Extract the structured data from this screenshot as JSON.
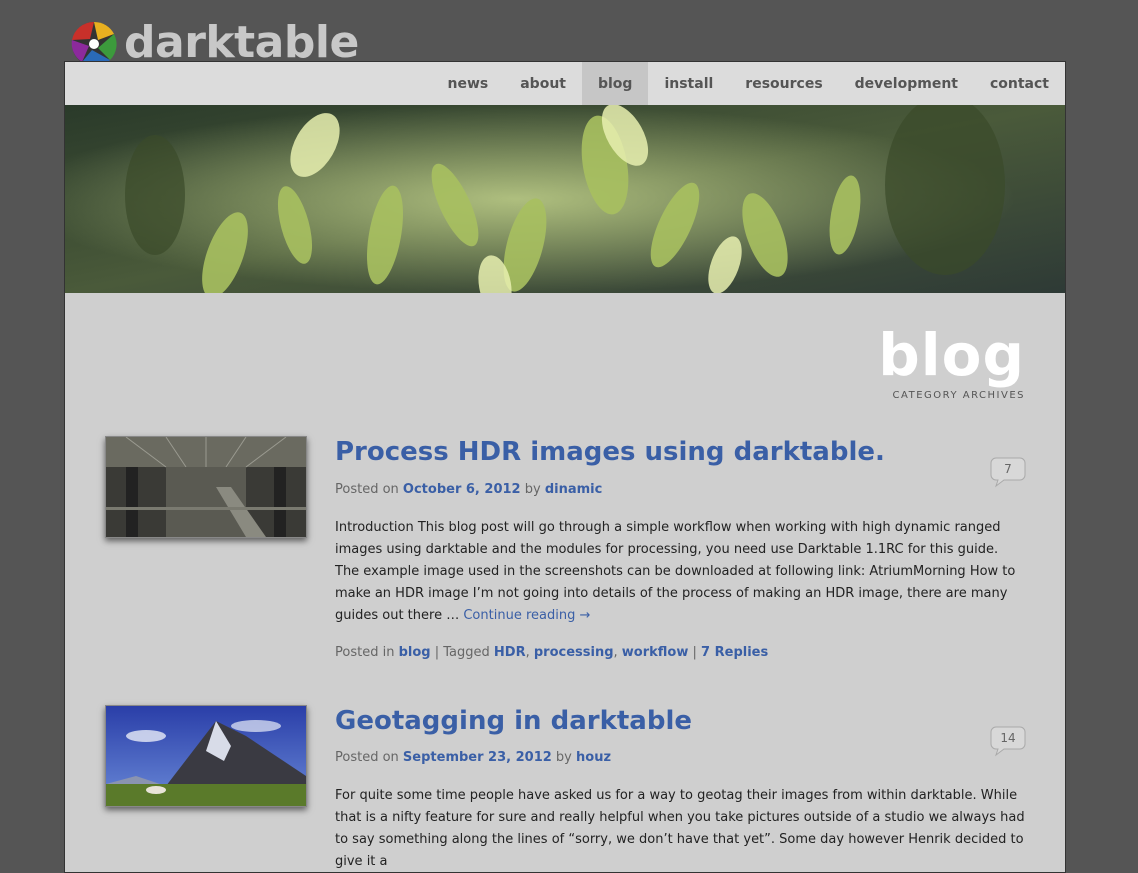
{
  "site": {
    "brand": "darktable"
  },
  "nav": {
    "items": [
      {
        "label": "news",
        "active": false
      },
      {
        "label": "about",
        "active": false
      },
      {
        "label": "blog",
        "active": true
      },
      {
        "label": "install",
        "active": false
      },
      {
        "label": "resources",
        "active": false
      },
      {
        "label": "development",
        "active": false
      },
      {
        "label": "contact",
        "active": false
      }
    ]
  },
  "archive": {
    "title": "blog",
    "subtitle": "CATEGORY ARCHIVES"
  },
  "posts": [
    {
      "title": "Process HDR images using darktable.",
      "posted_on_prefix": "Posted on",
      "date": "October 6, 2012",
      "by": "by",
      "author": "dinamic",
      "excerpt": "Introduction This blog post will go through a simple workflow when working with high dynamic ranged images using darktable and the modules for processing, you need use Darktable 1.1RC for this guide. The example image used in the screenshots can be downloaded at following link: AtriumMorning How to make an HDR image I’m not going into details of the process of making an HDR image, there are many guides out there …",
      "continue_label": "Continue reading →",
      "posted_in_prefix": "Posted in",
      "category": "blog",
      "separator1": "|",
      "tagged_prefix": "Tagged",
      "tags": [
        "HDR",
        "processing",
        "workflow"
      ],
      "separator2": "|",
      "replies_label": "7 Replies",
      "comment_count": "7",
      "thumb_icon": "atrium-photo"
    },
    {
      "title": "Geotagging in darktable",
      "posted_on_prefix": "Posted on",
      "date": "September 23, 2012",
      "by": "by",
      "author": "houz",
      "excerpt": "For quite some time people have asked us for a way to geotag their images from within darktable. While that is a nifty feature for sure and really helpful when you take pictures outside of a studio we always had to say something along the lines of “sorry, we don’t have that yet”. Some day however Henrik decided to give it a",
      "comment_count": "14",
      "thumb_icon": "mountain-photo"
    }
  ],
  "colors": {
    "background": "#555555",
    "page": "#cfcfcf",
    "link": "#3a5fa6",
    "nav_active": "#c6c6c6"
  }
}
